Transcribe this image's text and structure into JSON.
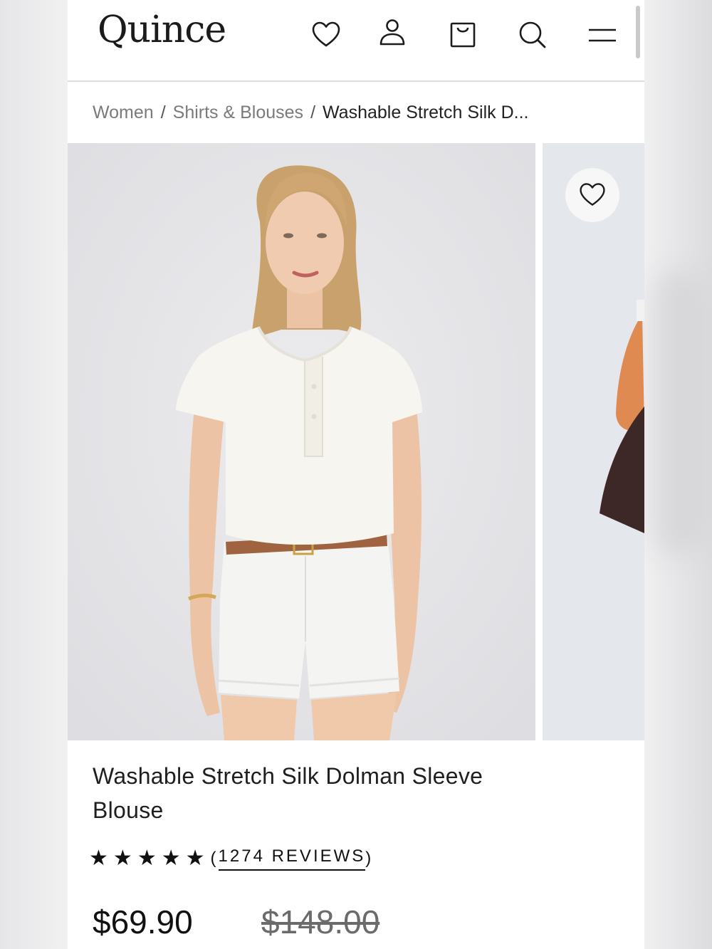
{
  "header": {
    "logo": "Quince",
    "icons": [
      "heart-icon",
      "user-icon",
      "shopping-bag-icon",
      "search-icon",
      "menu-icon"
    ]
  },
  "breadcrumb": {
    "items": [
      "Women",
      "Shirts & Blouses",
      "Washable Stretch Silk D..."
    ],
    "separator": "/"
  },
  "product": {
    "title": "Washable Stretch Silk Dolman Sleeve Blouse",
    "rating": 5,
    "reviews_label": "1274 REVIEWS",
    "reviews_open": "(",
    "reviews_close": ")",
    "price": "$69.90",
    "compare_price": "$148.00"
  },
  "colors": {
    "brand_text": "#1b1b1b",
    "image_bg": "#e7e6e9",
    "blouse": "#f7f5ef",
    "shorts": "#f4f4f2",
    "belt": "#a0633f"
  }
}
